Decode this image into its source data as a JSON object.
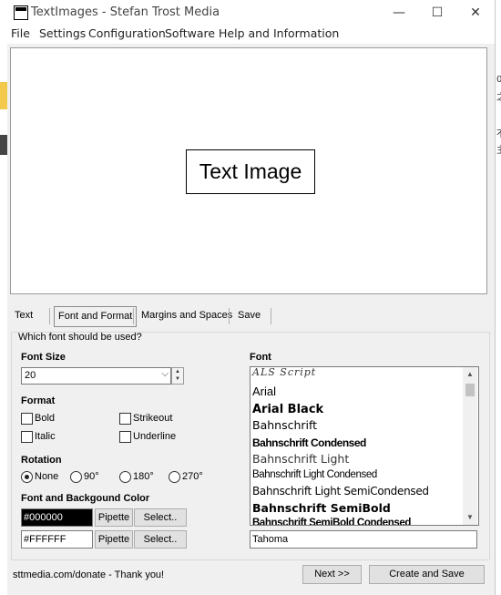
{
  "window": {
    "title": "TextImages - Stefan Trost Media",
    "minimize": "—",
    "maximize": "☐",
    "close": "✕"
  },
  "desktop_right_glyphs": [
    "0",
    "之",
    "不",
    "主"
  ],
  "menu": [
    "File",
    "Settings",
    "Configuration",
    "Software",
    "Help and Information"
  ],
  "preview": {
    "text": "Text Image"
  },
  "tabs": [
    "Text",
    "Font and Format",
    "Margins and Spaces",
    "Save"
  ],
  "active_tab": "Font and Format",
  "panel": {
    "question": "Which font should be used?",
    "font_size_heading": "Font Size",
    "font_size_value": "20",
    "format_heading": "Format",
    "format_options": [
      "Bold",
      "Strikeout",
      "Italic",
      "Underline"
    ],
    "rotation_heading": "Rotation",
    "rotation_options": [
      "None",
      "90°",
      "180°",
      "270°"
    ],
    "rotation_selected": "None",
    "color_heading": "Font and Backgound Color",
    "font_color": "#000000",
    "background_color": "#FFFFFF",
    "pipette_label": "Pipette",
    "select_label": "Select..",
    "font_heading": "Font",
    "font_list": [
      "ALS Script",
      "Arial",
      "Arial Black",
      "Bahnschrift",
      "Bahnschrift Condensed",
      "Bahnschrift Light",
      "Bahnschrift Light Condensed",
      "Bahnschrift Light SemiCondensed",
      "Bahnschrift SemiBold",
      "Bahnschrift SemiBold Condensed"
    ],
    "font_input_value": "Tahoma"
  },
  "footer": {
    "donate_text": "sttmedia.com/donate - Thank you!",
    "next_button": "Next >>",
    "create_save_button": "Create and Save"
  }
}
